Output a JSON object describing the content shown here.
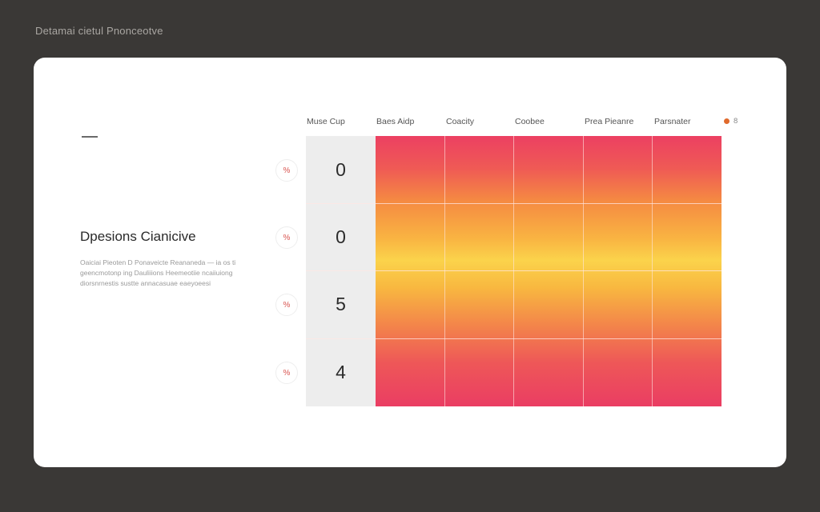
{
  "window": {
    "title": "Detamai cietul Pnonceotve"
  },
  "sidebar": {
    "title": "Dpesions Cianicive",
    "description": "Oaiciai Pieoten D Ponaveicte Reananeda — ia os ti geencmotonp ing Dauliiions Heemeotiie ncaiiuiong diorsnrnestis sustte annacasuae eaeyoeesi"
  },
  "table": {
    "headers": [
      "Muse Cup",
      "Baes Aidp",
      "Coacity",
      "Coobee",
      "Prea Pieanre",
      "Parsnater"
    ],
    "legend": {
      "label": "8",
      "color": "#e06a2c"
    },
    "rows": [
      {
        "marker": "%",
        "value": "0"
      },
      {
        "marker": "%",
        "value": "0"
      },
      {
        "marker": "%",
        "value": "5"
      },
      {
        "marker": "%",
        "value": "4"
      }
    ]
  },
  "colors": {
    "background": "#3a3836",
    "card": "#ffffff",
    "heat_top": "#ec4062",
    "heat_mid": "#fbd34b",
    "first_column": "#ededed"
  }
}
